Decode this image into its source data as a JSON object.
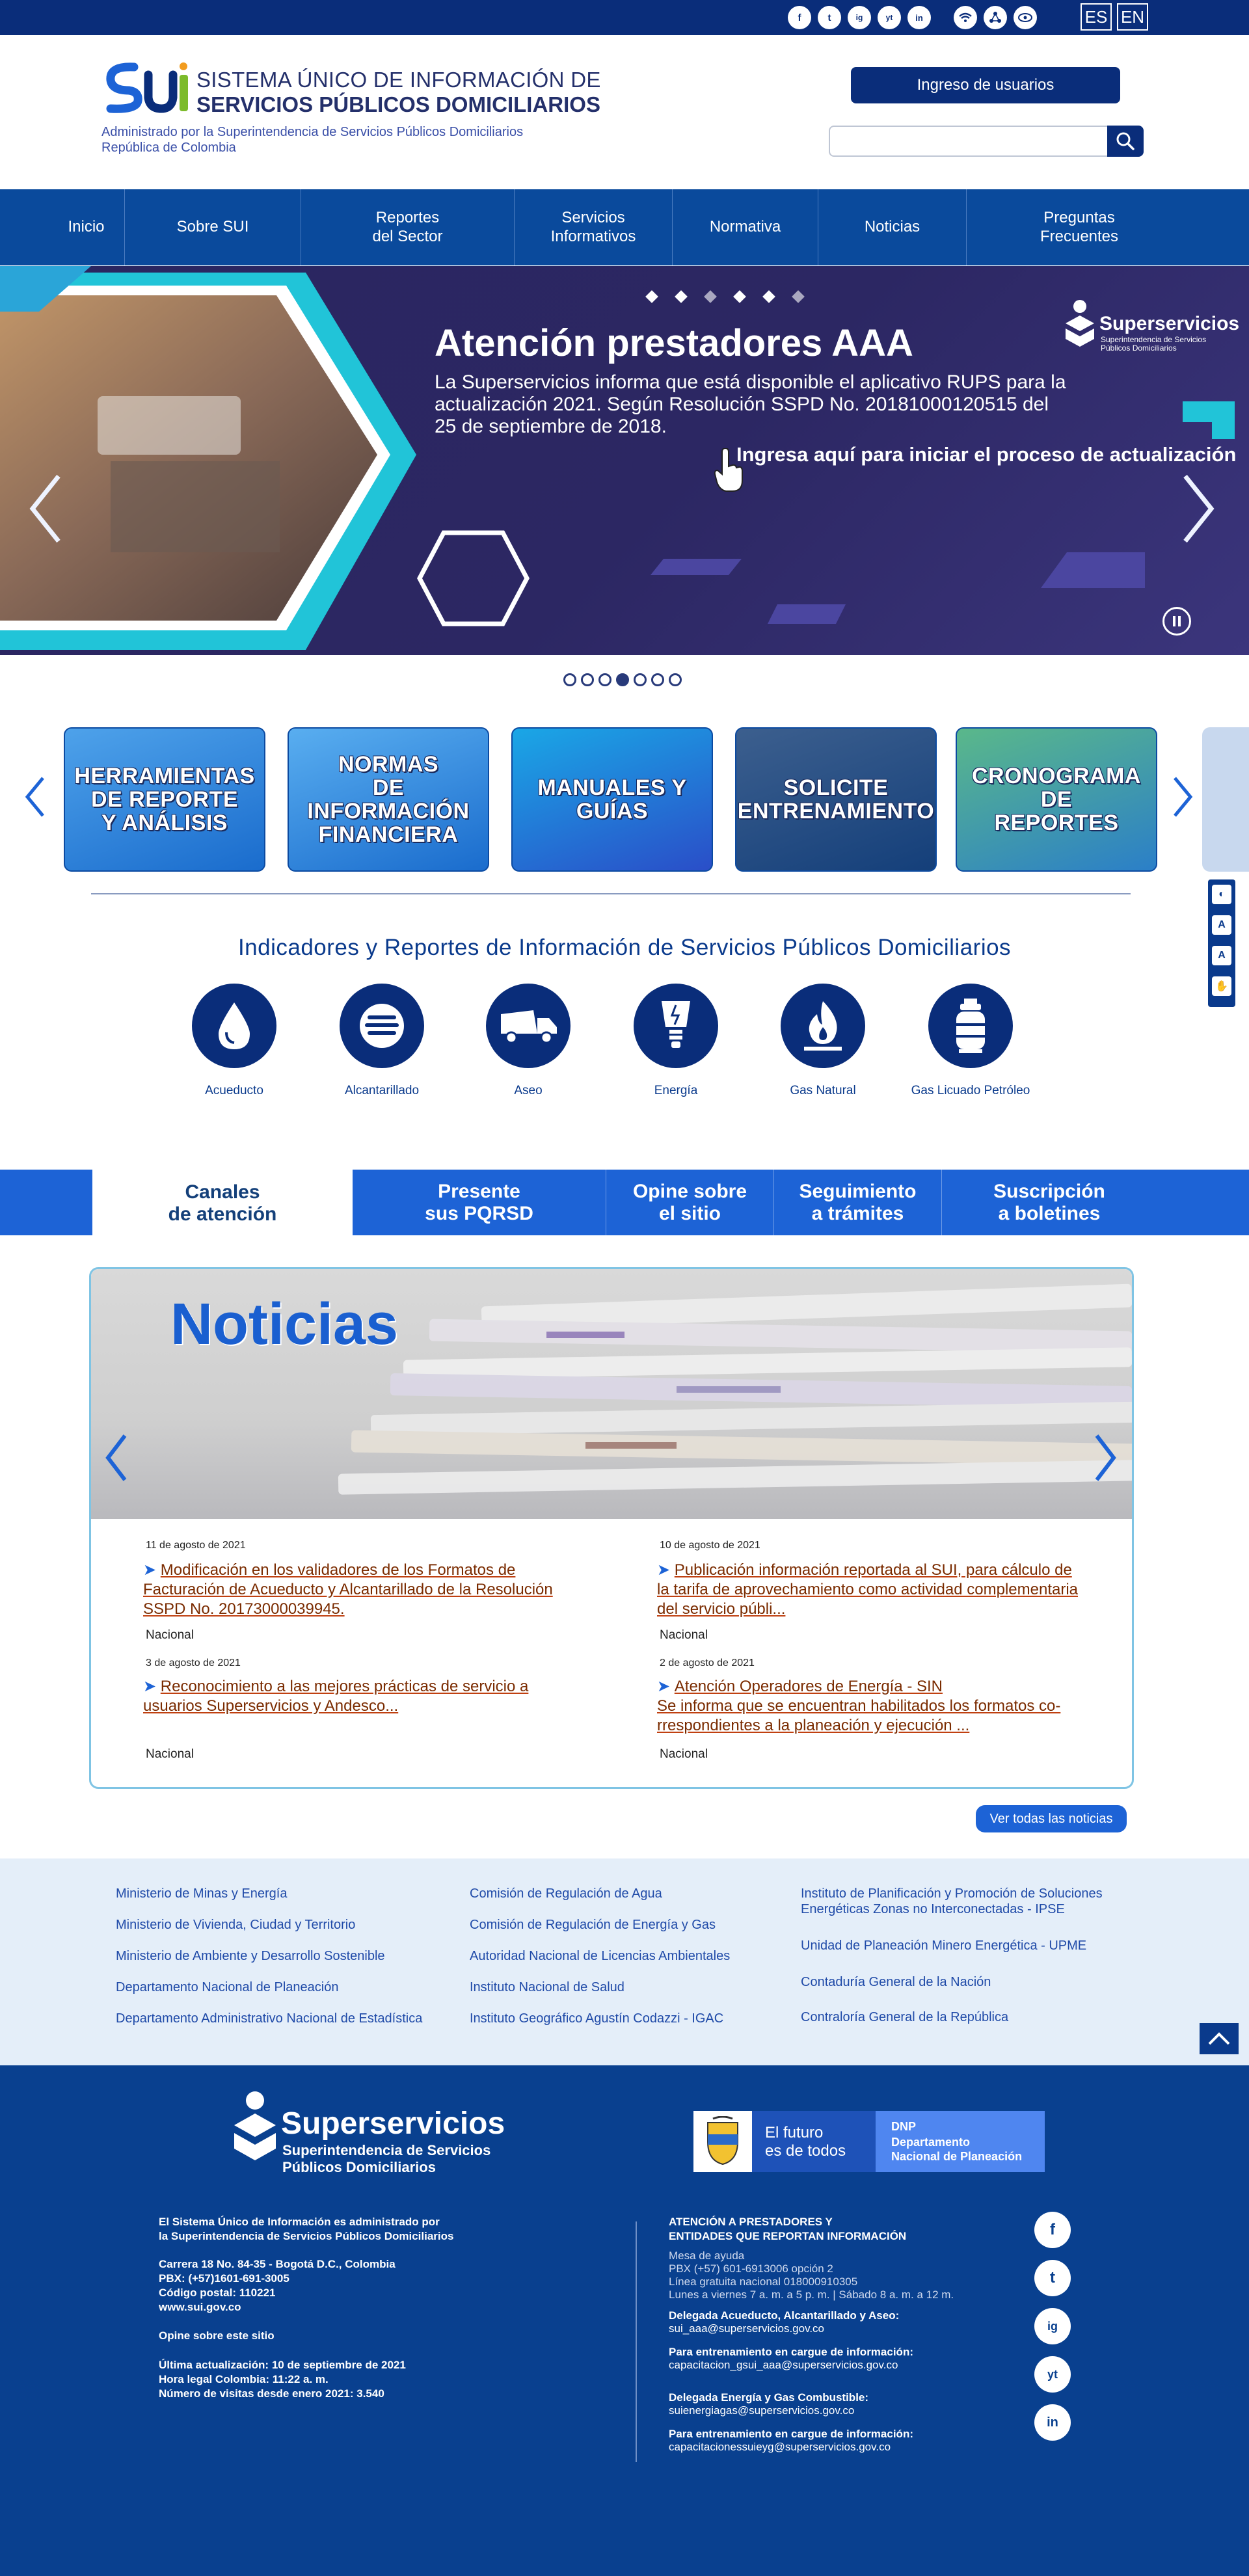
{
  "topbar": {
    "social": [
      "f",
      "t",
      "ig",
      "yt",
      "in"
    ],
    "extra_icons": [
      "wifi-icon",
      "network-icon",
      "sitemap-icon"
    ],
    "lang_es": "ES",
    "lang_en": "EN"
  },
  "header": {
    "title_line1": "SISTEMA ÚNICO DE INFORMACIÓN DE",
    "title_line2": "SERVICIOS PÚBLICOS DOMICILIARIOS",
    "subtitle_line1": "Administrado por la Superintendencia de Servicios Públicos Domiciliarios",
    "subtitle_line2": "República de Colombia",
    "login_label": "Ingreso de usuarios",
    "search_placeholder": ""
  },
  "nav": [
    {
      "label": "Inicio"
    },
    {
      "label": "Sobre SUI"
    },
    {
      "label": "Reportes\ndel Sector"
    },
    {
      "label": "Servicios\nInformativos"
    },
    {
      "label": "Normativa"
    },
    {
      "label": "Noticias"
    },
    {
      "label": "Preguntas\nFrecuentes"
    }
  ],
  "hero": {
    "heading": "Atención prestadores AAA",
    "text": "La Superservicios informa que está disponible el aplicativo RUPS para la actualización 2021. Según Resolución SSPD No. 20181000120515 del 25 de septiembre de 2018.",
    "cta": "Ingresa aquí para iniciar el proceso de actualización",
    "brand": "Superservicios",
    "brand_sub1": "Superintendencia de Servicios",
    "brand_sub2": "Públicos Domiciliarios",
    "slides": 7,
    "active_slide": 4
  },
  "tiles": [
    {
      "label": "HERRAMIENTAS\nDE REPORTE\nY ANÁLISIS"
    },
    {
      "label": "NORMAS\nDE INFORMACIÓN\nFINANCIERA"
    },
    {
      "label": "MANUALES Y\nGUÍAS"
    },
    {
      "label": "SOLICITE\nENTRENAMIENTO"
    },
    {
      "label": "CRONOGRAMA DE\nREPORTES"
    }
  ],
  "indicators": {
    "title": "Indicadores y Reportes de Información de Servicios Públicos Domiciliarios",
    "items": [
      {
        "label": "Acueducto",
        "icon": "water-drop-icon"
      },
      {
        "label": "Alcantarillado",
        "icon": "sewer-icon"
      },
      {
        "label": "Aseo",
        "icon": "garbage-truck-icon"
      },
      {
        "label": "Energía",
        "icon": "light-bulb-icon"
      },
      {
        "label": "Gas Natural",
        "icon": "flame-icon"
      },
      {
        "label": "Gas Licuado Petróleo",
        "icon": "gas-cylinder-icon"
      }
    ]
  },
  "tabs": [
    {
      "label": "Canales\nde atención"
    },
    {
      "label": "Presente\nsus PQRSD"
    },
    {
      "label": "Opine sobre\nel sitio"
    },
    {
      "label": "Seguimiento\na trámites"
    },
    {
      "label": "Suscripción\na boletines"
    }
  ],
  "news": {
    "title": "Noticias",
    "items": [
      {
        "date": "11 de agosto de 2021",
        "text": "Modificación en los validadores de los Formatos de Facturación de Acueducto y Alcantarillado de la Resolución SSPD No. 20173000039945.",
        "category": "Nacional"
      },
      {
        "date": "10 de agosto de 2021",
        "text": "Publicación información reportada al SUI, para cálculo de la tarifa de aprovechamiento como actividad complementaria del servicio públi...",
        "category": "Nacional"
      },
      {
        "date": "3 de agosto de 2021",
        "text": "Reconocimiento a las mejores prácticas de servicio a usuarios Superservicios y Andesco...",
        "category": "Nacional"
      },
      {
        "date": "2 de agosto de 2021",
        "text": "Atención Operadores de Energía - SIN\nSe informa que se encuentran habilitados los formatos co-rrespondientes a la planeación y ejecución ...",
        "category": "Nacional"
      }
    ],
    "view_all": "Ver todas las noticias"
  },
  "links": {
    "col1": [
      "Ministerio de Minas y Energía",
      "Ministerio de Vivienda, Ciudad y Territorio",
      "Ministerio de Ambiente y Desarrollo Sostenible",
      "Departamento Nacional de Planeación",
      "Departamento Administrativo Nacional de Estadística"
    ],
    "col2": [
      "Comisión de Regulación de Agua",
      "Comisión de Regulación de Energía y Gas",
      "Autoridad Nacional de Licencias Ambientales",
      "Instituto Nacional de Salud",
      "Instituto Geográfico Agustín Codazzi - IGAC"
    ],
    "col3": [
      "Instituto de Planificación y Promoción de Soluciones Energéticas Zonas no Interconectadas - IPSE",
      "Unidad de Planeación Minero Energética - UPME",
      "Contaduría General de la Nación",
      "Contraloría General de la República"
    ]
  },
  "footer": {
    "brand": "Superservicios",
    "brand_sub1": "Superintendencia de Servicios",
    "brand_sub2": "Públicos Domiciliarios",
    "dnp_left1": "El futuro",
    "dnp_left2": "es de todos",
    "dnp_right1": "DNP",
    "dnp_right2": "Departamento",
    "dnp_right3": "Nacional de Planeación",
    "admin1": "El Sistema Único de Información es administrado por",
    "admin2": "la Superintendencia de Servicios Públicos Domiciliarios",
    "addr1": "Carrera 18 No. 84-35 - Bogotá D.C., Colombia",
    "addr2": "PBX: (+57)1601-691-3005",
    "addr3": "Código postal: 110221",
    "addr4": "www.sui.gov.co",
    "opine": "Opine sobre este sitio",
    "upd1": "Última actualización: 10 de septiembre de 2021",
    "upd2": "Hora legal Colombia: 11:22 a. m.",
    "upd3": "Número de visitas desde enero 2021: 3.540",
    "att1": "ATENCIÓN A PRESTADORES Y",
    "att2": "ENTIDADES QUE REPORTAN INFORMACIÓN",
    "mesa1": "Mesa de ayuda",
    "mesa2": "PBX (+57) 601-6913006 opción 2",
    "mesa3": "Línea gratuita nacional 018000910305",
    "mesa4": "Lunes a viernes 7 a. m. a 5 p. m. | Sábado 8 a. m. a 12 m.",
    "d1t": "Delegada Acueducto, Alcantarillado y Aseo:",
    "d1m": "sui_aaa@superservicios.gov.co",
    "d2t": "Para entrenamiento en cargue de información:",
    "d2m": "capacitacion_gsui_aaa@superservicios.gov.co",
    "d3t": "Delegada Energía y Gas Combustible:",
    "d3m": "suienergiagas@superservicios.gov.co",
    "d4t": "Para entrenamiento en cargue de información:",
    "d4m": "capacitacionessuieyg@superservicios.gov.co",
    "social": [
      "f",
      "t",
      "ig",
      "yt",
      "in"
    ]
  },
  "colors": {
    "primary": "#0a2d7a",
    "nav": "#0a4a9c",
    "accent": "#1d63d6",
    "footer": "#09408f",
    "hero": "#2c2763",
    "teal": "#21c4d8"
  }
}
